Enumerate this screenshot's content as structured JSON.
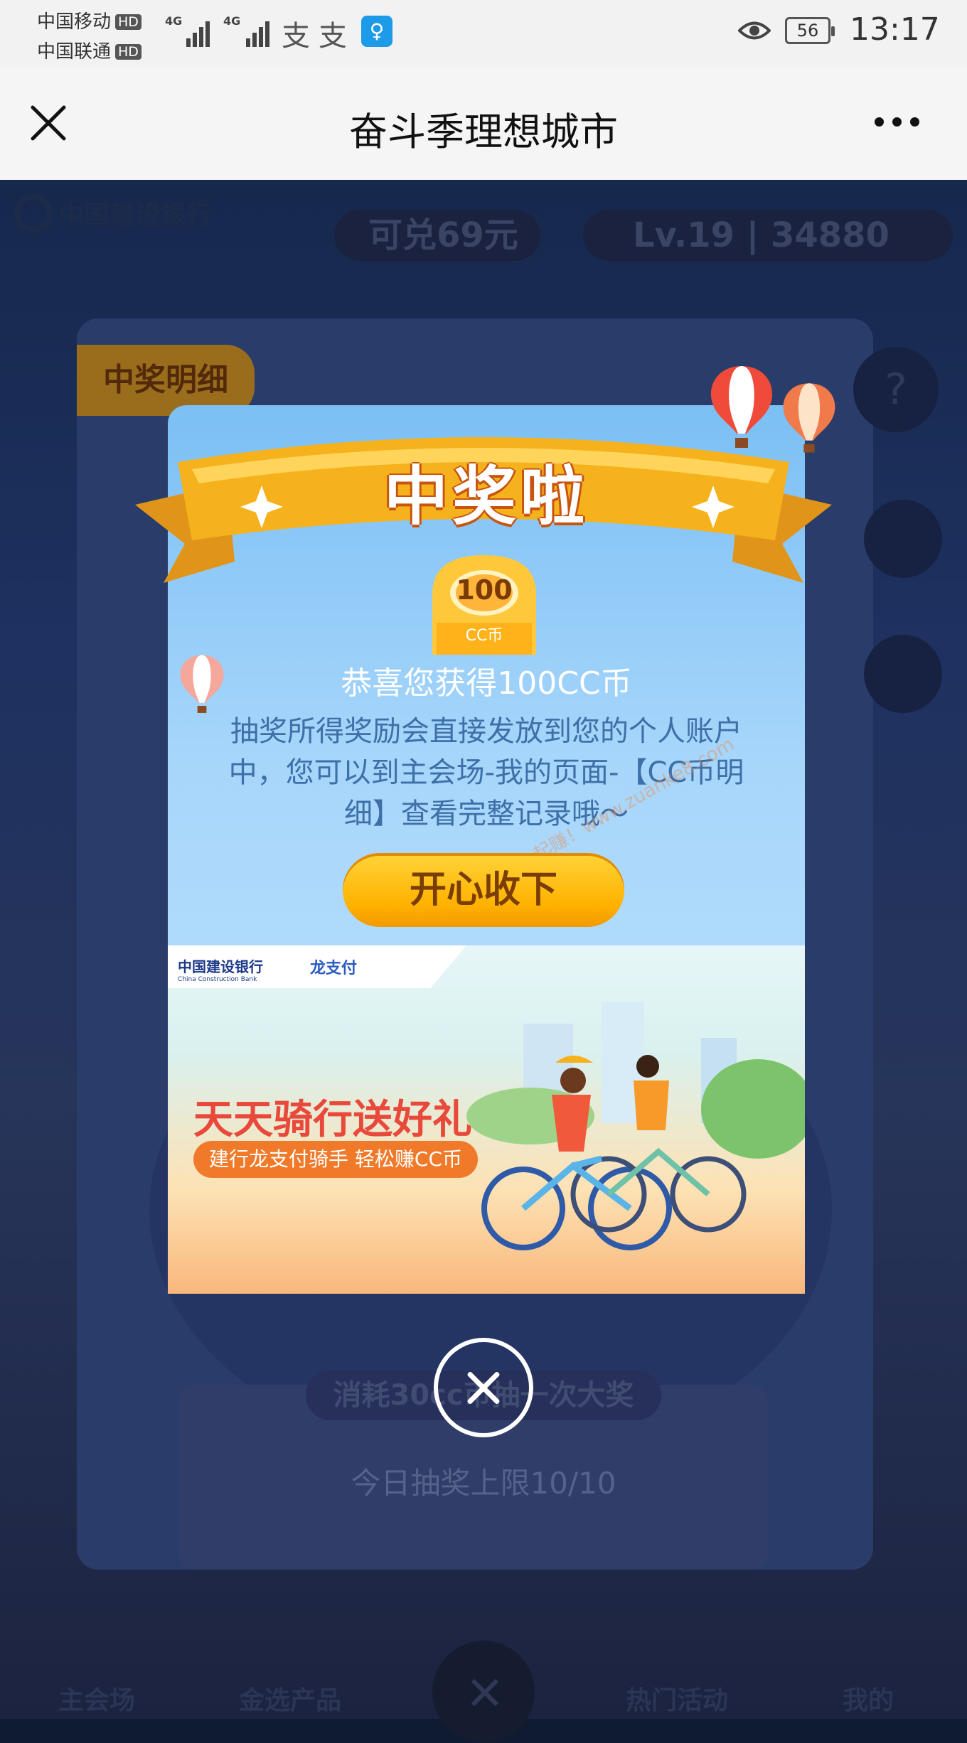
{
  "status_bar": {
    "carrier1": "中国移动",
    "carrier2": "中国联通",
    "hd_badge": "HD",
    "network1": "4G",
    "network2": "4G",
    "battery": "56",
    "time": "13:17"
  },
  "titlebar": {
    "title": "奋斗季理想城市"
  },
  "background": {
    "bank_logo": "中国建设银行",
    "points_pill": "可兑69元",
    "level_pill": "Lv.19 | 34880",
    "winners_tag": "中奖明细",
    "help": "?",
    "consume_text": "消耗30cc币抽一次大奖",
    "limit_text": "今日抽奖上限10/10",
    "tabs": [
      "主会场",
      "金选产品",
      "热门活动",
      "我的"
    ]
  },
  "dialog": {
    "ribbon_title": "中奖啦",
    "coin_value": "100",
    "coin_unit": "CC币",
    "congrats": "恭喜您获得100CC币",
    "description": "抽奖所得奖励会直接发放到您的个人账户中，您可以到主会场-我的页面-【CC币明细】查看完整记录哦～",
    "accept_button": "开心收下",
    "watermark": "赚客吧，有奖一起赚！www.zuanke8.com"
  },
  "ad": {
    "bank_name": "中国建设银行",
    "bank_name_en": "China Construction Bank",
    "pay_name": "龙支付",
    "headline": "天天骑行送好礼",
    "subline": "建行龙支付骑手 轻松赚CC币"
  },
  "colors": {
    "ribbon": "#f5b21d",
    "button": "#ffc21a",
    "headline": "#e8493a"
  }
}
